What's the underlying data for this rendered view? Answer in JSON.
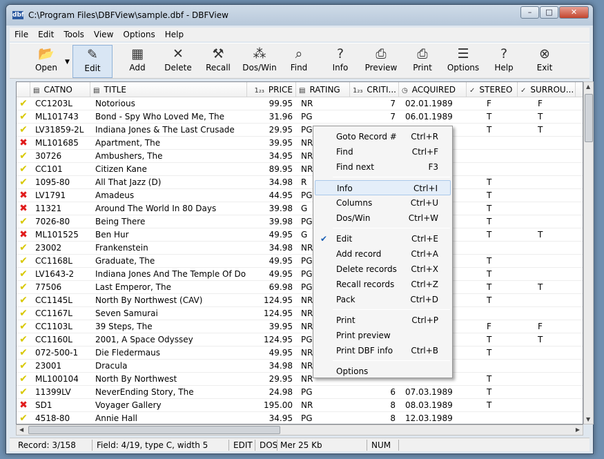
{
  "window": {
    "title": "C:\\Program Files\\DBFView\\sample.dbf - DBFView",
    "icon": "dbf"
  },
  "menu": [
    "File",
    "Edit",
    "Tools",
    "View",
    "Options",
    "Help"
  ],
  "toolbar": [
    {
      "label": "Open",
      "icon": "open-folder-icon"
    },
    {
      "label": "Edit",
      "icon": "edit-pencil-icon",
      "active": true
    },
    {
      "label": "Add",
      "icon": "add-record-icon"
    },
    {
      "label": "Delete",
      "icon": "delete-x-icon"
    },
    {
      "label": "Recall",
      "icon": "recall-hammer-icon"
    },
    {
      "label": "Dos/Win",
      "icon": "doswin-icon"
    },
    {
      "label": "Find",
      "icon": "find-magnifier-icon"
    },
    {
      "label": "Info",
      "icon": "info-icon"
    },
    {
      "label": "Preview",
      "icon": "preview-icon"
    },
    {
      "label": "Print",
      "icon": "printer-icon"
    },
    {
      "label": "Options",
      "icon": "options-icon"
    },
    {
      "label": "Help",
      "icon": "help-icon"
    },
    {
      "label": "Exit",
      "icon": "exit-icon"
    }
  ],
  "columns": [
    {
      "label": "CATNO",
      "icon": "text-field-icon"
    },
    {
      "label": "TITLE",
      "icon": "text-field-icon"
    },
    {
      "label": "PRICE",
      "icon": "numeric-field-icon"
    },
    {
      "label": "RATING",
      "icon": "text-field-icon"
    },
    {
      "label": "CRITI...",
      "icon": "numeric-field-icon"
    },
    {
      "label": "ACQUIRED",
      "icon": "date-field-icon"
    },
    {
      "label": "STEREO",
      "icon": "logical-field-icon"
    },
    {
      "label": "SURROU...",
      "icon": "logical-field-icon"
    }
  ],
  "rows": [
    {
      "m": "ok",
      "c": [
        "CC1203L",
        "Notorious",
        "99.95",
        "NR",
        "7",
        "02.01.1989",
        "F",
        "F"
      ]
    },
    {
      "m": "ok",
      "c": [
        "ML101743",
        "Bond - Spy Who Loved Me, The",
        "31.96",
        "PG",
        "7",
        "06.01.1989",
        "T",
        "T"
      ]
    },
    {
      "m": "ok",
      "c": [
        "LV31859-2L",
        "Indiana Jones & The Last Crusade",
        "29.95",
        "PG-13",
        "",
        "",
        "T",
        "T"
      ]
    },
    {
      "m": "del",
      "c": [
        "ML101685",
        "Apartment, The",
        "39.95",
        "NR",
        "",
        "",
        "",
        ""
      ]
    },
    {
      "m": "ok",
      "c": [
        "30726",
        "Ambushers, The",
        "34.95",
        "NR",
        "",
        "",
        "",
        ""
      ]
    },
    {
      "m": "ok",
      "c": [
        "CC101",
        "Citizen Kane",
        "89.95",
        "NR",
        "",
        "",
        "",
        ""
      ]
    },
    {
      "m": "ok",
      "c": [
        "1095-80",
        "All That Jazz (D)",
        "34.98",
        "R",
        "",
        "",
        "T",
        ""
      ]
    },
    {
      "m": "del",
      "c": [
        "LV1791",
        "Amadeus",
        "44.95",
        "PG",
        "",
        "",
        "T",
        ""
      ]
    },
    {
      "m": "del",
      "c": [
        "11321",
        "Around The World In 80 Days",
        "39.98",
        "G",
        "",
        "",
        "T",
        ""
      ]
    },
    {
      "m": "ok",
      "c": [
        "7026-80",
        "Being There",
        "39.98",
        "PG",
        "",
        "",
        "T",
        ""
      ]
    },
    {
      "m": "del",
      "c": [
        "ML101525",
        "Ben Hur",
        "49.95",
        "G",
        "",
        "",
        "T",
        "T"
      ]
    },
    {
      "m": "ok",
      "c": [
        "23002",
        "Frankenstein",
        "34.98",
        "NR",
        "",
        "",
        "",
        ""
      ]
    },
    {
      "m": "ok",
      "c": [
        "CC1168L",
        "Graduate, The",
        "49.95",
        "PG",
        "",
        "",
        "T",
        ""
      ]
    },
    {
      "m": "ok",
      "c": [
        "LV1643-2",
        "Indiana Jones And The Temple Of Doom",
        "49.95",
        "PG",
        "",
        "",
        "T",
        ""
      ]
    },
    {
      "m": "ok",
      "c": [
        "77506",
        "Last Emperor, The",
        "69.98",
        "PG",
        "",
        "",
        "T",
        "T"
      ]
    },
    {
      "m": "ok",
      "c": [
        "CC1145L",
        "North By Northwest  (CAV)",
        "124.95",
        "NR",
        "",
        "",
        "T",
        ""
      ]
    },
    {
      "m": "ok",
      "c": [
        "CC1167L",
        "Seven Samurai",
        "124.95",
        "NR",
        "",
        "",
        "",
        ""
      ]
    },
    {
      "m": "ok",
      "c": [
        "CC1103L",
        "39 Steps, The",
        "39.95",
        "NR",
        "",
        "",
        "F",
        "F"
      ]
    },
    {
      "m": "ok",
      "c": [
        "CC1160L",
        "2001, A Space Odyssey",
        "124.95",
        "PG-13",
        "",
        "",
        "T",
        "T"
      ]
    },
    {
      "m": "ok",
      "c": [
        "072-500-1",
        "Die Fledermaus",
        "49.95",
        "NR",
        "",
        "",
        "T",
        ""
      ]
    },
    {
      "m": "ok",
      "c": [
        "23001",
        "Dracula",
        "34.98",
        "NR",
        "",
        "",
        "",
        ""
      ]
    },
    {
      "m": "ok",
      "c": [
        "ML100104",
        "North By Northwest",
        "29.95",
        "NR",
        "",
        "",
        "T",
        ""
      ]
    },
    {
      "m": "ok",
      "c": [
        "11399LV",
        "NeverEnding Story, The",
        "24.98",
        "PG",
        "6",
        "07.03.1989",
        "T",
        ""
      ]
    },
    {
      "m": "del",
      "c": [
        "SD1",
        "Voyager Gallery",
        "195.00",
        "NR",
        "8",
        "08.03.1989",
        "T",
        ""
      ]
    },
    {
      "m": "ok",
      "c": [
        "4518-80",
        "Annie Hall",
        "34.95",
        "PG",
        "8",
        "12.03.1989",
        "",
        ""
      ]
    }
  ],
  "context_menu": [
    {
      "label": "Goto Record #",
      "key": "Ctrl+R"
    },
    {
      "label": "Find",
      "key": "Ctrl+F"
    },
    {
      "label": "Find next",
      "key": "F3"
    },
    {
      "sep": true
    },
    {
      "label": "Info",
      "key": "Ctrl+I",
      "highlight": true
    },
    {
      "label": "Columns",
      "key": "Ctrl+U"
    },
    {
      "label": "Dos/Win",
      "key": "Ctrl+W"
    },
    {
      "sep": true
    },
    {
      "label": "Edit",
      "key": "Ctrl+E",
      "checked": true
    },
    {
      "label": "Add record",
      "key": "Ctrl+A"
    },
    {
      "label": "Delete records",
      "key": "Ctrl+X"
    },
    {
      "label": "Recall records",
      "key": "Ctrl+Z"
    },
    {
      "label": "Pack",
      "key": "Ctrl+D"
    },
    {
      "sep": true
    },
    {
      "label": "Print",
      "key": "Ctrl+P"
    },
    {
      "label": "Print preview",
      "key": ""
    },
    {
      "label": "Print DBF info",
      "key": "Ctrl+B"
    },
    {
      "sep": true
    },
    {
      "label": "Options",
      "key": ""
    }
  ],
  "status": {
    "record": "Record: 3/158",
    "field": "Field: 4/19, type C, width 5",
    "mode": "EDIT",
    "encoding": "DOS",
    "mem_label": "Mem",
    "mem": "25 Kb",
    "num": "NUM"
  },
  "colors": {
    "highlight": "#e4eef9",
    "deleted_mark": "#e01a1a",
    "ok_mark": "#d8c800"
  }
}
